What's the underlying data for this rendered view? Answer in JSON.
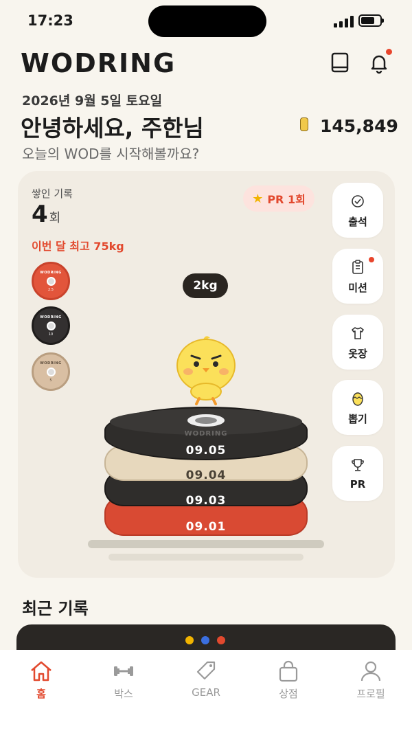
{
  "status_bar": {
    "time": "17:23"
  },
  "app": {
    "logo": "WODRING"
  },
  "header": {
    "date": "2026년 9월 5일 토요일",
    "greeting": "안녕하세요, 주한님",
    "subtitle": "오늘의 WOD를 시작해볼까요?",
    "points": "145,849"
  },
  "stack_card": {
    "label": "쌓인 기록",
    "count": "4",
    "count_unit": "회",
    "best": "이번 달 최고 75kg",
    "pr_badge": "PR 1회",
    "current_weight": "2kg",
    "mini_plates": [
      {
        "brand": "WODRING",
        "num": "2.5",
        "color": "#e2553b"
      },
      {
        "brand": "WODRING",
        "num": "10",
        "color": "#333030"
      },
      {
        "brand": "WODRING",
        "num": "5",
        "color": "#d9bfa3"
      }
    ],
    "plates": [
      {
        "date": "09.05",
        "color": "#2f2d2b",
        "text_color": "#ffffff"
      },
      {
        "date": "09.04",
        "color": "#e7d8bd",
        "text_color": "#4a4236"
      },
      {
        "date": "09.03",
        "color": "#2f2d2b",
        "text_color": "#ffffff"
      },
      {
        "date": "09.01",
        "color": "#e5533a",
        "text_color": "#ffffff"
      }
    ],
    "top_plate_brand": "WODRING"
  },
  "side_menu": [
    {
      "label": "출석",
      "icon": "check-badge-icon",
      "has_dot": false
    },
    {
      "label": "미션",
      "icon": "clipboard-icon",
      "has_dot": true
    },
    {
      "label": "옷장",
      "icon": "shirt-icon",
      "has_dot": false
    },
    {
      "label": "뽑기",
      "icon": "egg-icon",
      "has_dot": false
    },
    {
      "label": "PR",
      "icon": "trophy-icon",
      "has_dot": false
    }
  ],
  "recent": {
    "title": "최근 기록",
    "dot_colors": [
      "#f2b400",
      "#3b6fe0",
      "#e2492e"
    ]
  },
  "tabbar": [
    {
      "label": "홈",
      "icon": "home-icon",
      "active": true
    },
    {
      "label": "박스",
      "icon": "dumbbell-icon",
      "active": false
    },
    {
      "label": "GEAR",
      "icon": "tag-icon",
      "active": false
    },
    {
      "label": "상점",
      "icon": "shopping-bag-icon",
      "active": false
    },
    {
      "label": "프로필",
      "icon": "profile-icon",
      "active": false
    }
  ],
  "colors": {
    "accent": "#e2492e",
    "background": "#f8f5ee",
    "card": "#f1ece3"
  }
}
